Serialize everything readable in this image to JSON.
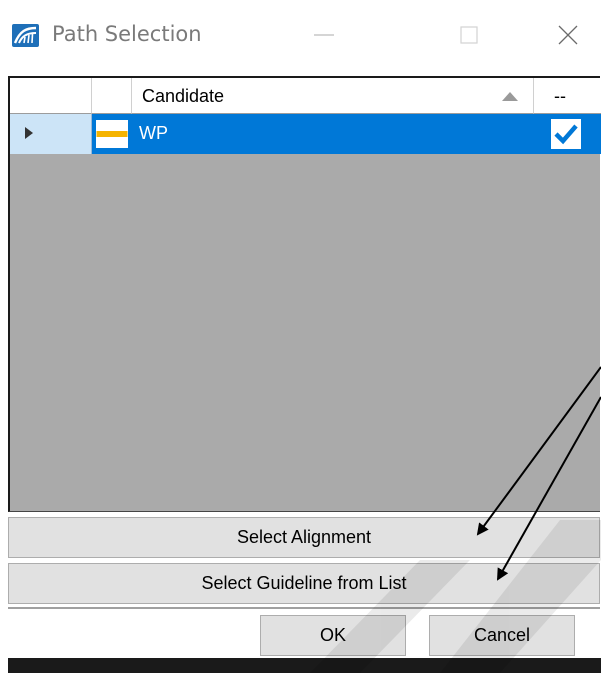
{
  "window": {
    "title": "Path Selection",
    "icon": "bridge-app-icon",
    "controls": [
      "minimize-icon",
      "maximize-icon",
      "close-icon"
    ]
  },
  "grid": {
    "columns": [
      {
        "key": "indicator",
        "label": ""
      },
      {
        "key": "swatch",
        "label": ""
      },
      {
        "key": "candidate",
        "label": "Candidate",
        "sort": "ascending"
      },
      {
        "key": "check",
        "label": "--"
      }
    ],
    "rows": [
      {
        "candidate": "WP",
        "checked": true,
        "selected": true,
        "swatch_colors": [
          "#ffffff",
          "#f5b400"
        ]
      }
    ]
  },
  "buttons": {
    "select_alignment": "Select Alignment",
    "select_guideline": "Select Guideline from List",
    "ok": "OK",
    "cancel": "Cancel"
  },
  "colors": {
    "selection": "#0078d7",
    "grid_empty": "#aaaaaa",
    "indicator_selected": "#cce4f7",
    "brand": "#1e6fb8"
  }
}
